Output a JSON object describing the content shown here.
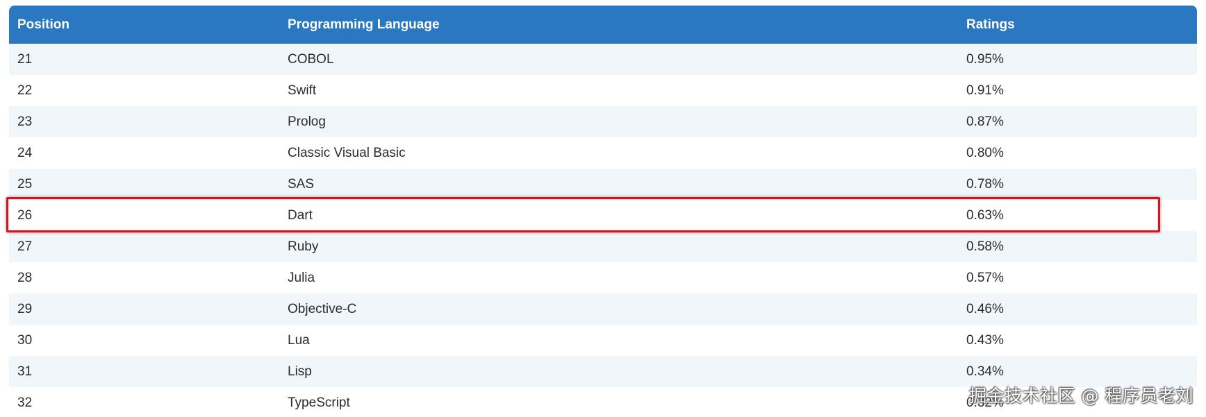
{
  "table": {
    "headers": {
      "position": "Position",
      "language": "Programming Language",
      "ratings": "Ratings"
    },
    "rows": [
      {
        "position": "21",
        "language": "COBOL",
        "rating": "0.95%"
      },
      {
        "position": "22",
        "language": "Swift",
        "rating": "0.91%"
      },
      {
        "position": "23",
        "language": "Prolog",
        "rating": "0.87%"
      },
      {
        "position": "24",
        "language": "Classic Visual Basic",
        "rating": "0.80%"
      },
      {
        "position": "25",
        "language": "SAS",
        "rating": "0.78%"
      },
      {
        "position": "26",
        "language": "Dart",
        "rating": "0.63%"
      },
      {
        "position": "27",
        "language": "Ruby",
        "rating": "0.58%"
      },
      {
        "position": "28",
        "language": "Julia",
        "rating": "0.57%"
      },
      {
        "position": "29",
        "language": "Objective-C",
        "rating": "0.46%"
      },
      {
        "position": "30",
        "language": "Lua",
        "rating": "0.43%"
      },
      {
        "position": "31",
        "language": "Lisp",
        "rating": "0.34%"
      },
      {
        "position": "32",
        "language": "TypeScript",
        "rating": "0.32%"
      }
    ]
  },
  "highlight": {
    "row_position": "26",
    "color": "#d9111b"
  },
  "colors": {
    "header_bg": "#2a77c2",
    "row_alt_bg": "#f1f6fb"
  },
  "watermark": "掘金技术社区 @ 程序员老刘"
}
